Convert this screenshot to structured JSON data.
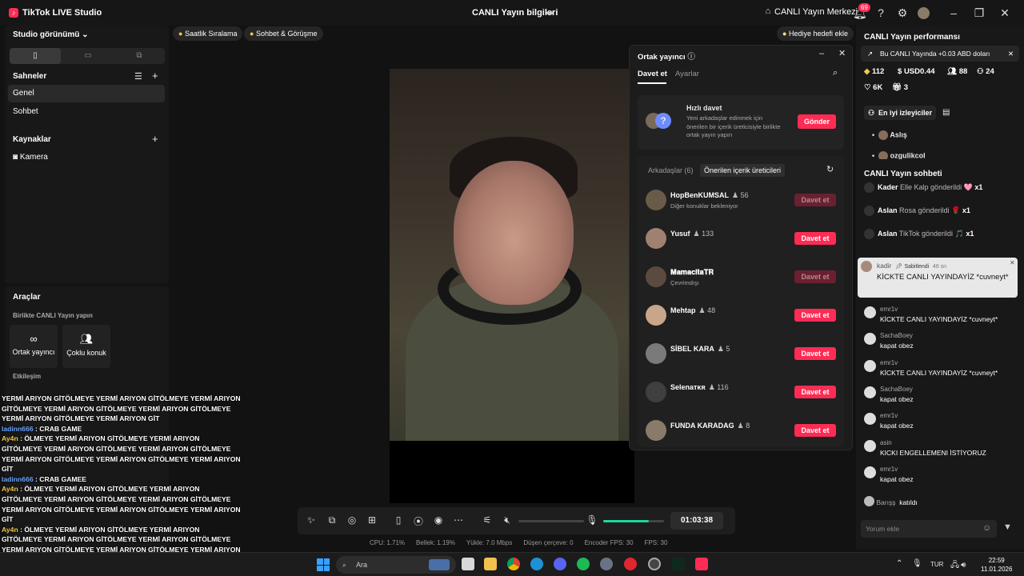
{
  "titlebar": {
    "app_title": "TikTok LIVE Studio",
    "stream_info": "CANLI Yayın bilgileri",
    "center_link": "CANLI Yayın Merkezi",
    "notification_count": "69"
  },
  "left": {
    "view_title": "Studio görünümü",
    "scenes_title": "Sahneler",
    "scenes": [
      "Genel",
      "Sohbet"
    ],
    "sources_title": "Kaynaklar",
    "sources": [
      "Kamera"
    ],
    "tools_title": "Araçlar",
    "collab_title": "Birlikte CANLI Yayın yapın",
    "collab_tools": [
      "Ortak yayıncı",
      "Çoklu konuk"
    ],
    "interaction_title": "Etkileşim"
  },
  "top_pills": [
    "Saatlik Sıralama",
    "Sohbet & Görüşme",
    "Hediye hedefi ekle"
  ],
  "overlay": {
    "lines": [
      {
        "type": "text",
        "text": "YERMİ ARIYON GİTÖLMEYE YERMİ ARIYON GİTÖLMEYE YERMİ ARIYON GİTÖLMEYE YERMİ ARIYON GİTÖLMEYE YERMİ ARIYON GİTÖLMEYE YERMİ ARIYON GİTÖLMEYE YERMİ ARIYON GİT"
      },
      {
        "type": "msg",
        "user": "ladinn666",
        "text": " : CRAB GAME",
        "color": "u1"
      },
      {
        "type": "msg",
        "user": "Ay4n",
        "text": " : ÖLMEYE YERMİ ARIYON GİTÖLMEYE YERMİ ARIYON GİTÖLMEYE YERMİ ARIYON GİTÖLMEYE YERMİ ARIYON GİTÖLMEYE YERMİ ARIYON GİTÖLMEYE YERMİ ARIYON GİTÖLMEYE YERMİ ARIYON GİT",
        "color": "u2"
      },
      {
        "type": "msg",
        "user": "ladinn666",
        "text": " : CRAB GAMEE",
        "color": "u1"
      },
      {
        "type": "msg",
        "user": "Ay4n",
        "text": " : ÖLMEYE YERMİ ARIYON GİTÖLMEYE YERMİ ARIYON GİTÖLMEYE YERMİ ARIYON GİTÖLMEYE YERMİ ARIYON GİTÖLMEYE YERMİ ARIYON GİTÖLMEYE YERMİ ARIYON GİTÖLMEYE YERMİ ARIYON GİT",
        "color": "u2"
      },
      {
        "type": "msg",
        "user": "Ay4n",
        "text": " : ÖLMEYE YERMİ ARIYON GİTÖLMEYE YERMİ ARIYON GİTÖLMEYE YERMİ ARIYON GİTÖLMEYE YERMİ ARIYON GİTÖLMEYE YERMİ ARIYON GİTÖLMEYE YERMİ ARIYON GİTÖLMEYE YERMİ ARIYON GİT",
        "color": "u2"
      }
    ]
  },
  "guest_panel": {
    "title": "Ortak yayıncı",
    "tabs": [
      "Davet et",
      "Ayarlar"
    ],
    "quick_invite": {
      "title": "Hızlı davet",
      "description": "Yeni arkadaşlar edinmek için önerilen bir içerik üreticisiyle birlikte ortak yayın yapın",
      "button": "Gönder"
    },
    "segments": [
      "Arkadaşlar (6)",
      "Önerilen içerik üreticileri"
    ],
    "invite_label": "Davet et",
    "creators": [
      {
        "name": "HopBenKUMSAL",
        "count": "56",
        "sub": "Diğer konuklar bekleniyor",
        "enabled": false
      },
      {
        "name": "Yusuf",
        "count": "133",
        "sub": "",
        "enabled": true
      },
      {
        "name": "𝐌𝐚𝐦𝐚𝐜𝐢𝐭𝐚𝐓𝐑",
        "count": "",
        "sub": "Çevrimdışı",
        "enabled": false
      },
      {
        "name": "Mehtap",
        "count": "48",
        "sub": "",
        "enabled": true
      },
      {
        "name": "SİBEL KARA",
        "count": "5",
        "sub": "",
        "enabled": true
      },
      {
        "name": "Selenaᴛᴋʀ",
        "count": "116",
        "sub": "",
        "enabled": true
      },
      {
        "name": "FUNDA KARADAG",
        "count": "8",
        "sub": "",
        "enabled": true
      }
    ]
  },
  "controls": {
    "timer": "01:03:38",
    "mic_level": 0.75,
    "status": [
      "CPU: 1.71%",
      "Bellek: 1.19%",
      "Yükle: 7.0 Mbps",
      "Düşen çerçeve: 0",
      "Encoder FPS: 30",
      "FPS: 30"
    ]
  },
  "right": {
    "perf_title": "CANLI Yayın performansı",
    "perf_banner": "Bu CANLI Yayında +0.03 ABD doları",
    "stats": [
      "112",
      "USD0.44",
      "88",
      "24",
      "6K",
      "3"
    ],
    "top_viewers": "En iyi izleyiciler",
    "viewers": [
      "Aslış",
      "ozgulikcol"
    ],
    "chat_title": "CANLI Yayın sohbeti",
    "gifts": [
      {
        "user": "Kader",
        "text": "Elle Kalp gönderildi",
        "mult": "x1"
      },
      {
        "user": "Aslan",
        "text": "Rosa gönderildi",
        "mult": "x1"
      },
      {
        "user": "Aslan",
        "text": "TikTok gönderildi",
        "mult": "x1"
      }
    ],
    "pinned": {
      "user": "kadir",
      "tag": "Sabitlendi",
      "time": "46 sn",
      "text": "KİCKTE CANLI YAYINDAYİZ *cuvneyt*"
    },
    "comments": [
      {
        "user": "emr1v",
        "text": "KİCKTE CANLI YAYINDAYİZ *cuvneyt*"
      },
      {
        "user": "SachaBoey",
        "text": "kapat obez"
      },
      {
        "user": "emr1v",
        "text": "KİCKTE CANLI YAYINDAYİZ *cuvneyt*"
      },
      {
        "user": "SachaBoey",
        "text": "kapat obez"
      },
      {
        "user": "emr1v",
        "text": "kapat obez"
      },
      {
        "user": "asin",
        "text": "KICKI ENGELLEMENI İSTİYORUZ"
      },
      {
        "user": "emr1v",
        "text": "kapat obez"
      }
    ],
    "joined": {
      "user": "Barışş",
      "text": "katıldı"
    },
    "comment_placeholder": "Yorum ekle"
  },
  "taskbar": {
    "search": "Ara",
    "lang": "TUR",
    "time": "22:59",
    "date": "11.01.2026"
  },
  "colors": {
    "accent": "#fe2c55",
    "mic": "#20d5a0"
  }
}
